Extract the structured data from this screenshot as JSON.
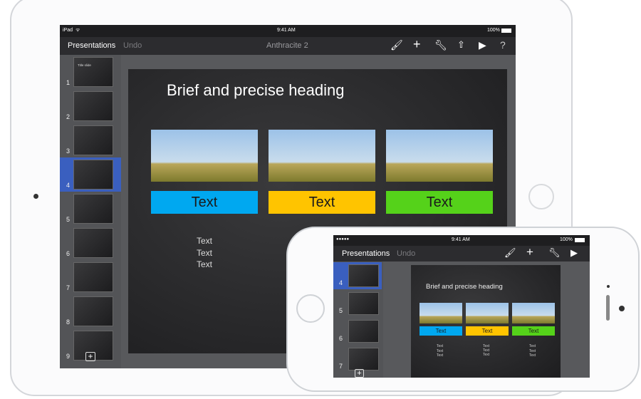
{
  "ipad": {
    "status": {
      "carrier": "iPad",
      "time": "9:41 AM",
      "battery": "100%"
    },
    "toolbar": {
      "presentations": "Presentations",
      "undo": "Undo",
      "title": "Anthracite 2"
    },
    "thumbnails": [
      {
        "num": "1",
        "title": "Title slide"
      },
      {
        "num": "2"
      },
      {
        "num": "3"
      },
      {
        "num": "4",
        "selected": true
      },
      {
        "num": "5"
      },
      {
        "num": "6"
      },
      {
        "num": "7"
      },
      {
        "num": "8"
      },
      {
        "num": "9"
      }
    ],
    "slide": {
      "heading": "Brief and precise heading",
      "bars": [
        {
          "label": "Text",
          "color": "#00a8f0"
        },
        {
          "label": "Text",
          "color": "#ffc400"
        },
        {
          "label": "Text",
          "color": "#55d21a"
        }
      ],
      "texts": [
        "Text",
        "Text",
        "Text"
      ]
    }
  },
  "iphone": {
    "status": {
      "signal": "●●●●●",
      "time": "9:41 AM",
      "battery": "100%"
    },
    "toolbar": {
      "presentations": "Presentations",
      "undo": "Undo"
    },
    "thumbnails": [
      {
        "num": "4",
        "selected": true
      },
      {
        "num": "5"
      },
      {
        "num": "6"
      },
      {
        "num": "7"
      }
    ],
    "slide": {
      "heading": "Brief and precise heading",
      "bars": [
        {
          "label": "Text",
          "color": "#00a8f0"
        },
        {
          "label": "Text",
          "color": "#ffc400"
        },
        {
          "label": "Text",
          "color": "#55d21a"
        }
      ],
      "columns": [
        [
          "Text",
          "Text",
          "Text"
        ],
        [
          "Text",
          "Text",
          "Text"
        ],
        [
          "Text",
          "Text",
          "Text"
        ]
      ]
    }
  },
  "accent": "#3a5fbf"
}
